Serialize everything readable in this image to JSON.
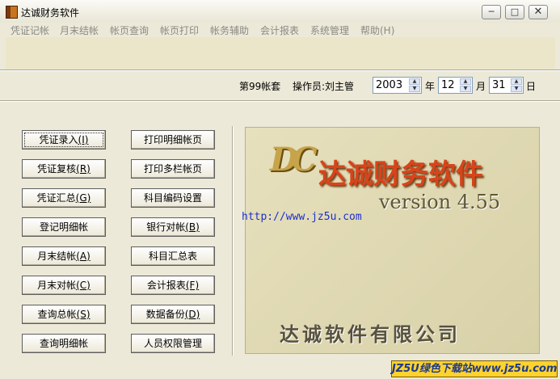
{
  "window": {
    "title": "达诚财务软件"
  },
  "menu": [
    "凭证记帐",
    "月末结帐",
    "帐页查询",
    "帐页打印",
    "帐务辅助",
    "会计报表",
    "系统管理",
    "帮助(H)"
  ],
  "info": {
    "account_set": "第99帐套",
    "operator": "操作员:刘主管",
    "year": "2003",
    "year_unit": "年",
    "month": "12",
    "month_unit": "月",
    "day": "31",
    "day_unit": "日"
  },
  "left_buttons": [
    {
      "label": "凭证录入",
      "key": "(I)"
    },
    {
      "label": "凭证复核",
      "key": "(R)"
    },
    {
      "label": "凭证汇总",
      "key": "(G)"
    },
    {
      "label": "登记明细帐",
      "key": ""
    },
    {
      "label": "月末结帐",
      "key": "(A)"
    },
    {
      "label": "月末对帐",
      "key": "(C)"
    },
    {
      "label": "查询总帐",
      "key": "(S)"
    },
    {
      "label": "查询明细帐",
      "key": ""
    }
  ],
  "right_buttons": [
    {
      "label": "打印明细帐页",
      "key": ""
    },
    {
      "label": "打印多栏帐页",
      "key": ""
    },
    {
      "label": "科目编码设置",
      "key": ""
    },
    {
      "label": "银行对帐",
      "key": "(B)"
    },
    {
      "label": "科目汇总表",
      "key": ""
    },
    {
      "label": "会计报表",
      "key": "(F)"
    },
    {
      "label": "数据备份",
      "key": "(D)"
    },
    {
      "label": "人员权限管理",
      "key": ""
    }
  ],
  "banner": {
    "logo": "DC",
    "brand": "达诚财务软件",
    "version": "version 4.55",
    "url": "http://www.jz5u.com",
    "company": "达诚软件有限公司"
  },
  "watermark": "JZ5U绿色下载站www.jz5u.com"
}
